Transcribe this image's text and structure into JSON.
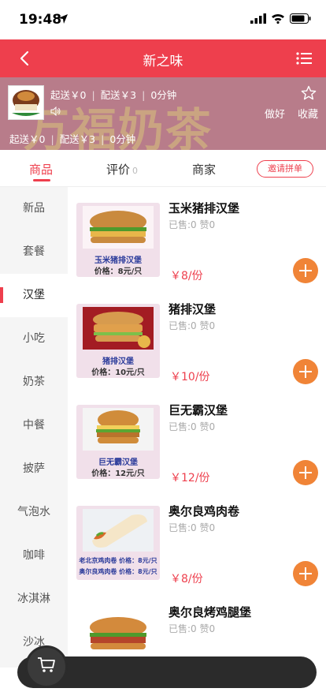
{
  "status_bar": {
    "time": "19:48"
  },
  "nav": {
    "title": "新之味"
  },
  "shop": {
    "banner_text": "万福奶茶",
    "min_delivery": "起送￥0",
    "delivery_fee": "配送￥3",
    "delivery_time": "0分钟",
    "min_delivery_2": "起送￥0",
    "delivery_fee_2": "配送￥3",
    "delivery_time_2": "0分钟",
    "slogan": "做好",
    "favorite_label": "收藏"
  },
  "tabs": {
    "goods": "商品",
    "reviews": "评价",
    "reviews_count": "0",
    "merchant": "商家",
    "group_order": "邀请拼单"
  },
  "categories": [
    "新品",
    "套餐",
    "汉堡",
    "小吃",
    "奶茶",
    "中餐",
    "披萨",
    "气泡水",
    "咖啡",
    "冰淇淋",
    "沙冰"
  ],
  "active_category": "汉堡",
  "products": [
    {
      "name": "玉米猪排汉堡",
      "sales": "已售:0 赞0",
      "price": "￥8/份",
      "img_caption": "玉米猪排汉堡",
      "img_price": "价格：8元/只"
    },
    {
      "name": "猪排汉堡",
      "sales": "已售:0 赞0",
      "price": "￥10/份",
      "img_caption": "猪排汉堡",
      "img_price": "价格：10元/只"
    },
    {
      "name": "巨无霸汉堡",
      "sales": "已售:0 赞0",
      "price": "￥12/份",
      "img_caption": "巨无霸汉堡",
      "img_price": "价格：12元/只"
    },
    {
      "name": "奥尔良鸡肉卷",
      "sales": "已售:0 赞0",
      "price": "￥8/份",
      "img_caption": "老北京鸡肉卷 价格：8元/只",
      "img_price": "奥尔良鸡肉卷 价格：8元/只"
    },
    {
      "name": "奥尔良烤鸡腿堡",
      "sales": "已售:0 赞0",
      "price": "",
      "img_caption": "",
      "img_price": ""
    }
  ],
  "colors": {
    "brand": "#ee3f4d",
    "add_button": "#f08437",
    "price": "#ee3f4d"
  }
}
